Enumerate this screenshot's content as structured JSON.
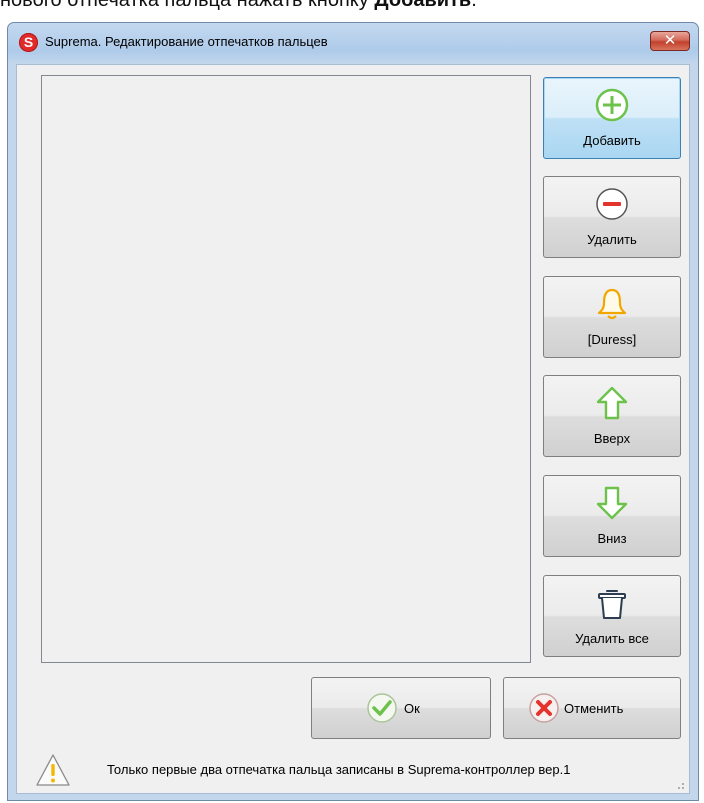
{
  "doc_fragment": {
    "text": "нового отпечатка пальца нажать кнопку ",
    "bold": "Добавить",
    "tail": "."
  },
  "window": {
    "title": "Suprema. Редактирование отпечатков пальцев",
    "app_icon_letter": "S",
    "close_symbol": "✕"
  },
  "buttons": {
    "add": "Добавить",
    "delete": "Удалить",
    "duress": "[Duress]",
    "up": "Вверх",
    "down": "Вниз",
    "delete_all": "Удалить все",
    "ok": "Ок",
    "cancel": "Отменить"
  },
  "status": {
    "message": "Только первые два отпечатка пальца записаны в Suprema-контроллер вер.1"
  },
  "icons": {
    "add": "plus-circle-icon",
    "delete": "minus-circle-icon",
    "duress": "bell-icon",
    "up": "arrow-up-icon",
    "down": "arrow-down-icon",
    "delete_all": "trash-icon",
    "ok": "checkmark-icon",
    "cancel": "cross-icon",
    "status": "warning-icon"
  },
  "colors": {
    "add_accent": "#6cc24a",
    "delete_accent": "#e5342c",
    "duress_accent": "#f2a700",
    "arrow_accent": "#6cc24a",
    "trash_accent": "#2c3e50",
    "warning_accent": "#f2b900"
  }
}
